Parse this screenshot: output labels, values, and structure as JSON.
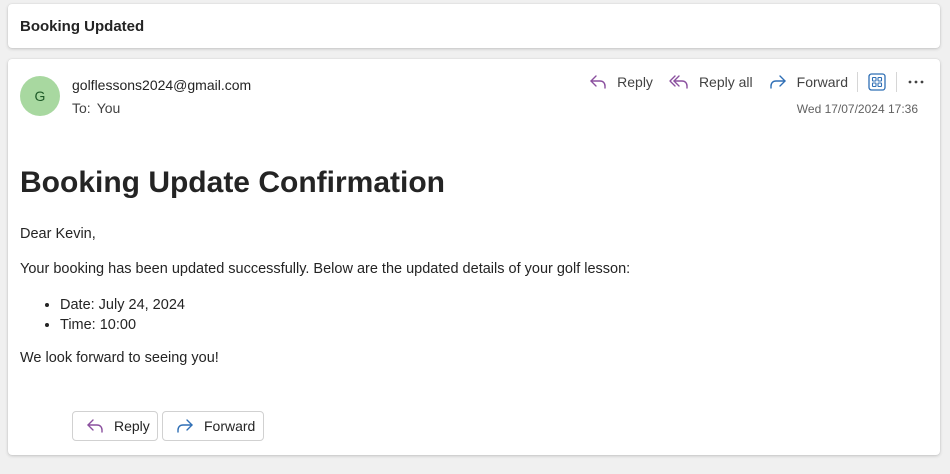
{
  "subject": "Booking Updated",
  "sender": {
    "avatar_initial": "G",
    "email": "golflessons2024@gmail.com",
    "to_label": "To:",
    "to_value": "You"
  },
  "actions": {
    "reply": "Reply",
    "reply_all": "Reply all",
    "forward": "Forward"
  },
  "timestamp": "Wed 17/07/2024 17:36",
  "body": {
    "heading": "Booking Update Confirmation",
    "greeting": "Dear Kevin,",
    "intro": "Your booking has been updated successfully. Below are the updated details of your golf lesson:",
    "details": [
      "Date: July 24, 2024",
      "Time: 10:00"
    ],
    "closing": "We look forward to seeing you!"
  },
  "footer": {
    "reply": "Reply",
    "forward": "Forward"
  },
  "icons": {
    "reply": "reply-arrow-icon",
    "reply_all": "reply-all-icon",
    "forward": "forward-arrow-icon",
    "apps": "apps-grid-icon",
    "more": "more-horizontal-icon"
  },
  "colors": {
    "reply_accent": "#8a4f9e",
    "forward_accent": "#2f6fb5",
    "avatar_bg": "#a8d8a0"
  }
}
